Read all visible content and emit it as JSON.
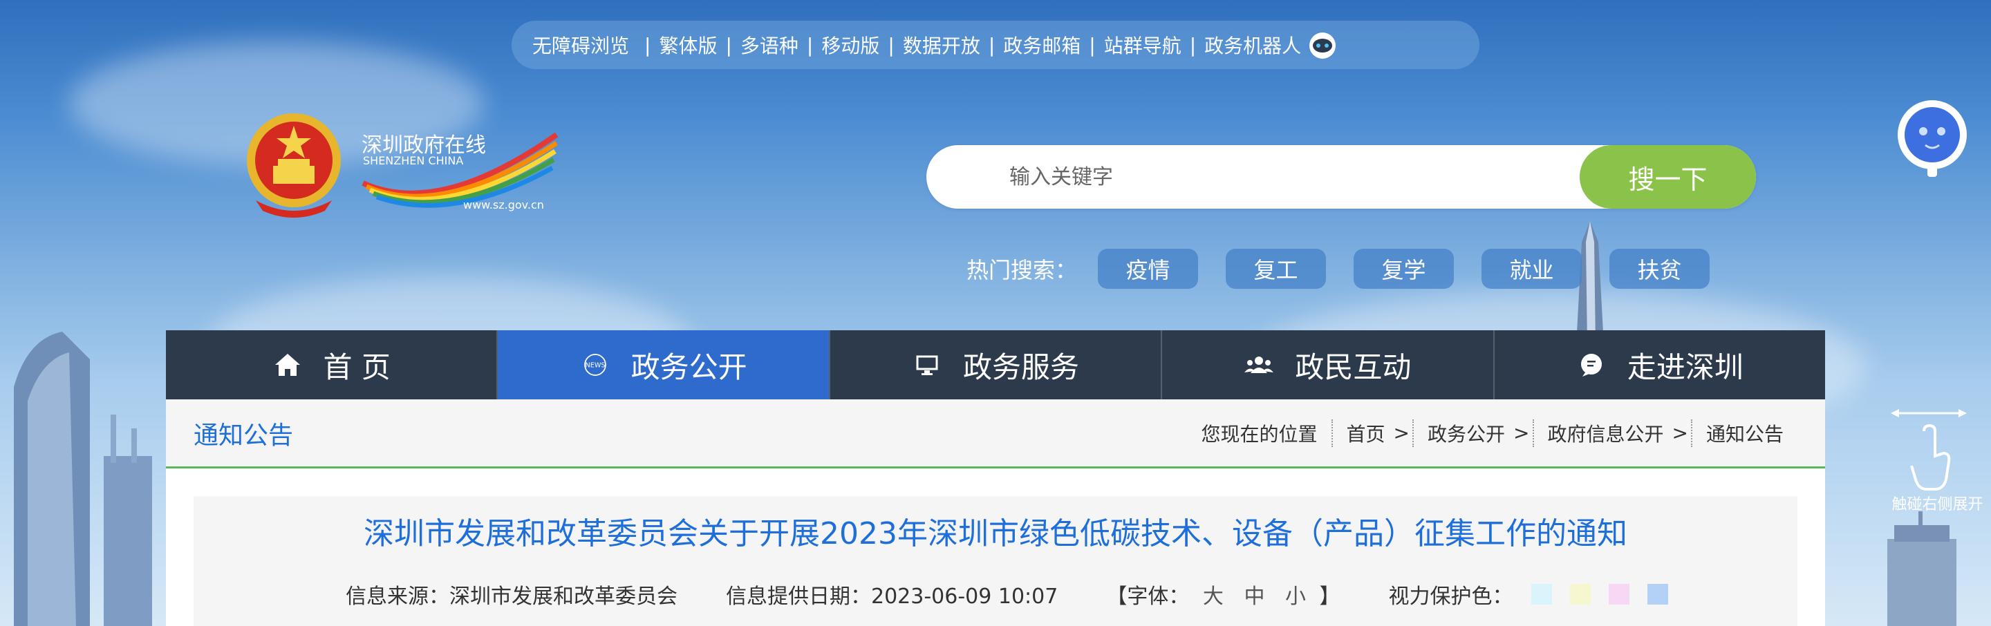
{
  "top_links": {
    "accessible": "无障碍浏览",
    "traditional": "繁体版",
    "multilang": "多语种",
    "mobile": "移动版",
    "open_data": "数据开放",
    "mail": "政务邮箱",
    "sites": "站群导航",
    "robot": "政务机器人",
    "sep": "|"
  },
  "logo": {
    "name_cn": "深圳政府在线",
    "name_en": "SHENZHEN CHINA",
    "url": "www.sz.gov.cn"
  },
  "search": {
    "placeholder": "输入关键字",
    "button": "搜一下"
  },
  "hot_search": {
    "label": "热门搜索：",
    "tags": [
      "疫情",
      "复工",
      "复学",
      "就业",
      "扶贫"
    ]
  },
  "nav": {
    "items": [
      {
        "label": "首 页",
        "icon": "home-icon"
      },
      {
        "label": "政务公开",
        "icon": "news-icon"
      },
      {
        "label": "政务服务",
        "icon": "monitor-icon"
      },
      {
        "label": "政民互动",
        "icon": "people-icon"
      },
      {
        "label": "走进深圳",
        "icon": "chat-icon"
      }
    ],
    "active_index": 1
  },
  "breadcrumb": {
    "section_title": "通知公告",
    "location_label": "您现在的位置",
    "path": [
      "首页",
      "政务公开",
      "政府信息公开",
      "通知公告"
    ],
    "arrow": ">"
  },
  "article": {
    "title": "深圳市发展和改革委员会关于开展2023年深圳市绿色低碳技术、设备（产品）征集工作的通知",
    "source": "信息来源：深圳市发展和改革委员会",
    "date": "信息提供日期：2023-06-09 10:07",
    "font_label_open": "【字体：",
    "font_sizes": [
      "大",
      "中",
      "小"
    ],
    "font_label_close": "】",
    "eye_label": "视力保护色：",
    "eye_colors": [
      "#d9f5fb",
      "#f7f7cf",
      "#f6d8f4",
      "#b3d1f7"
    ]
  },
  "side": {
    "tip": "触碰右侧展开"
  },
  "colors": {
    "nav_bg": "#2c3a4c",
    "nav_active": "#2e6bcc",
    "accent_blue": "#1e6fd9",
    "search_btn": "#8bc34a",
    "divider_green": "#5cb85c"
  }
}
